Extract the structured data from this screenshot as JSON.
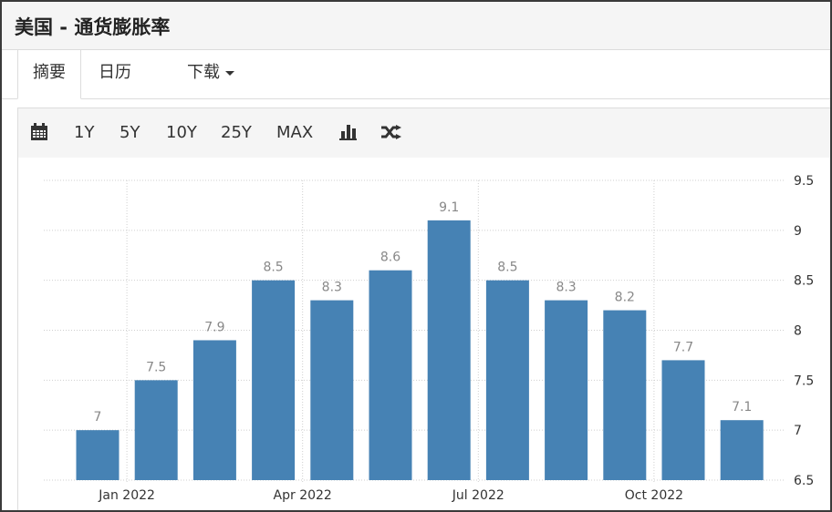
{
  "header": {
    "title": "美国 - 通货膨胀率"
  },
  "tabs": [
    {
      "label": "摘要"
    },
    {
      "label": "日历"
    },
    {
      "label": "下载"
    }
  ],
  "toolbar": {
    "ranges": [
      "1Y",
      "5Y",
      "10Y",
      "25Y",
      "MAX"
    ],
    "icons": [
      "calendar-icon",
      "bar-chart-icon",
      "shuffle-icon"
    ]
  },
  "colors": {
    "bar": "#4682b4",
    "grid": "#cfcfcf",
    "label": "#888888",
    "axis_text": "#333333"
  },
  "chart_data": {
    "type": "bar",
    "values": [
      7.0,
      7.5,
      7.9,
      8.5,
      8.3,
      8.6,
      9.1,
      8.5,
      8.3,
      8.2,
      7.7,
      7.1
    ],
    "data_labels": [
      "7",
      "7.5",
      "7.9",
      "8.5",
      "8.3",
      "8.6",
      "9.1",
      "8.5",
      "8.3",
      "8.2",
      "7.7",
      "7.1"
    ],
    "x_tick_labels": [
      "Jan 2022",
      "Apr 2022",
      "Jul 2022",
      "Oct 2022"
    ],
    "x_tick_after_bar": [
      0,
      3,
      6,
      9
    ],
    "y_ticks": [
      "6.5",
      "7",
      "7.5",
      "8",
      "8.5",
      "9",
      "9.5"
    ],
    "ylim": [
      6.5,
      9.5
    ],
    "y_axis_side": "right",
    "grid": true
  }
}
